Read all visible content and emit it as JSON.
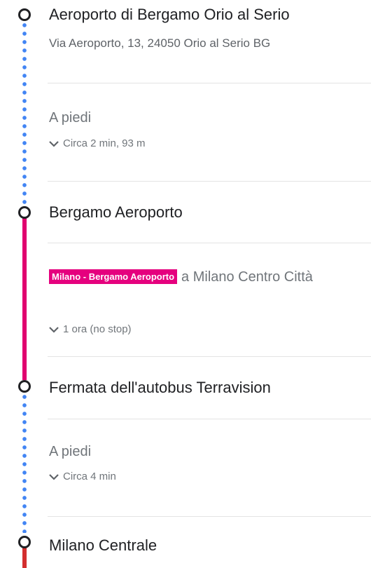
{
  "origin": {
    "name": "Aeroporto di Bergamo Orio al Serio",
    "address": "Via Aeroporto, 13, 24050 Orio al Serio BG"
  },
  "walk1": {
    "mode": "A piedi",
    "detail": "Circa 2 min, 93 m"
  },
  "stop1": {
    "name": "Bergamo Aeroporto"
  },
  "bus": {
    "line_name": "Milano - Bergamo Aeroporto",
    "line_color": "#e5007e",
    "destination": "a Milano Centro Città",
    "detail": "1 ora (no stop)"
  },
  "stop2": {
    "name": "Fermata dell'autobus Terravision"
  },
  "walk2": {
    "mode": "A piedi",
    "detail": "Circa 4 min"
  },
  "destination": {
    "name": "Milano Centrale"
  },
  "colors": {
    "walk_dots": "#4285f4",
    "bus_line": "#e0006f",
    "final_line": "#d32f2f"
  },
  "icons": {
    "expand": "chevron-down-icon",
    "stop": "stop-circle-icon"
  }
}
